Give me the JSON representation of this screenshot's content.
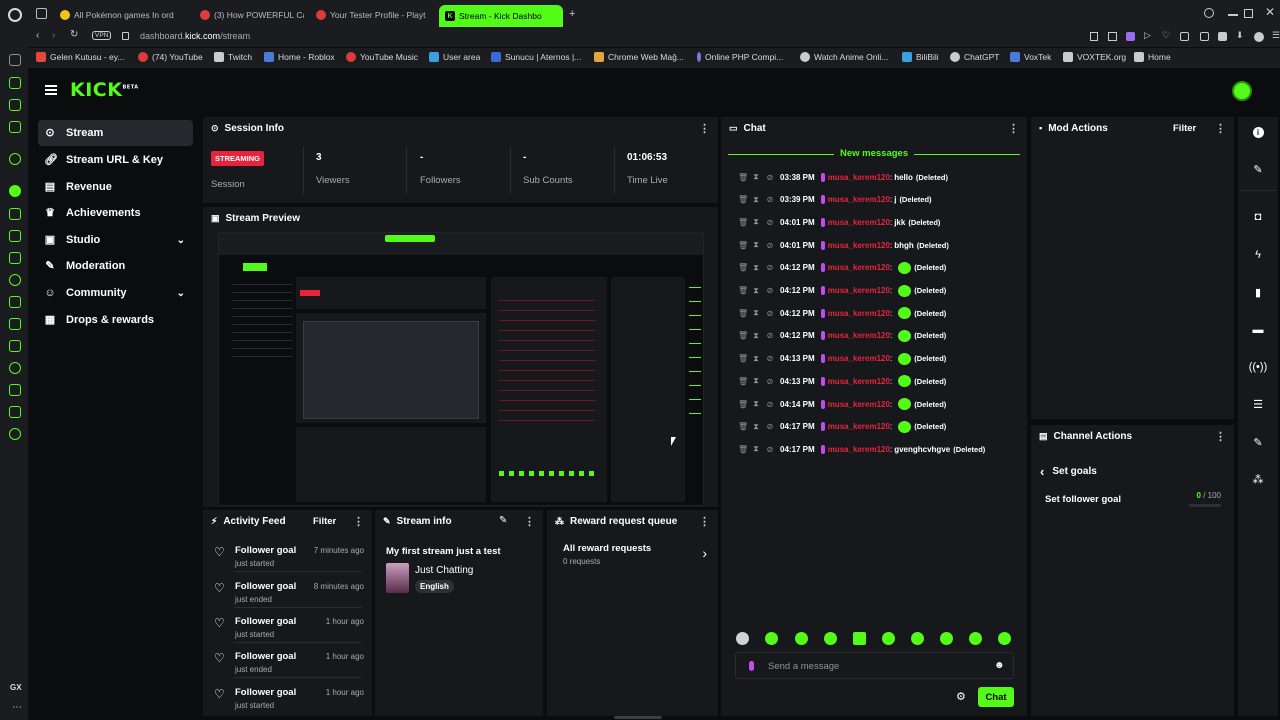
{
  "browser": {
    "tabs": [
      {
        "label": "All Pokémon games In ord",
        "favicon_color": "#f4c21c"
      },
      {
        "label": "(3) How POWERFUL Can",
        "favicon_color": "#e03b3b"
      },
      {
        "label": "Your Tester Profile - Playt",
        "favicon_color": "#e03b3b"
      },
      {
        "label": "Stream - Kick Dashbo",
        "favicon_color": "#000000"
      }
    ],
    "new_tab": "+",
    "vpn": "VPN",
    "url_prefix": "dashboard.",
    "url_host": "kick.com",
    "url_path": "/stream",
    "bookmarks": [
      "Gelen Kutusu - ey...",
      "(74) YouTube",
      "Twitch",
      "Home - Roblox",
      "YouTube Music",
      "User area",
      "Sunucu | Aternos |...",
      "Chrome Web Mağ...",
      "Online PHP Compi...",
      "Watch Anime Onli...",
      "BiliBili",
      "ChatGPT",
      "VoxTek",
      "VOXTEK.org",
      "Home"
    ]
  },
  "kick": {
    "logo": "KICK",
    "beta": "BETA",
    "accent": "#53fc18"
  },
  "nav": [
    {
      "label": "Stream",
      "icon": "broadcast-icon"
    },
    {
      "label": "Stream URL & Key",
      "icon": "link-icon"
    },
    {
      "label": "Revenue",
      "icon": "chart-icon"
    },
    {
      "label": "Achievements",
      "icon": "trophy-icon"
    },
    {
      "label": "Studio",
      "icon": "studio-icon"
    },
    {
      "label": "Moderation",
      "icon": "wrench-icon"
    },
    {
      "label": "Community",
      "icon": "users-icon"
    },
    {
      "label": "Drops & rewards",
      "icon": "gift-icon"
    }
  ],
  "session": {
    "title": "Session Info",
    "badge": "STREAMING",
    "badge_label": "Session",
    "viewers_value": "3",
    "viewers_label": "Viewers",
    "followers_value": "-",
    "followers_label": "Followers",
    "subs_value": "-",
    "subs_label": "Sub Counts",
    "time_value": "01:06:53",
    "time_label": "Time Live"
  },
  "preview": {
    "title": "Stream Preview"
  },
  "activity": {
    "title": "Activity Feed",
    "filter": "Filter",
    "items": [
      {
        "title": "Follower goal",
        "sub": "just started",
        "when": "7 minutes ago"
      },
      {
        "title": "Follower goal",
        "sub": "just ended",
        "when": "8 minutes ago"
      },
      {
        "title": "Follower goal",
        "sub": "just started",
        "when": "1 hour ago"
      },
      {
        "title": "Follower goal",
        "sub": "just ended",
        "when": "1 hour ago"
      },
      {
        "title": "Follower goal",
        "sub": "just started",
        "when": "1 hour ago"
      }
    ]
  },
  "stream_info": {
    "title": "Stream info",
    "stream_title": "My first stream just a test",
    "category": "Just Chatting",
    "language": "English"
  },
  "rewards": {
    "title": "Reward request queue",
    "all_label": "All reward requests",
    "count_label": "0 requests"
  },
  "chat": {
    "title": "Chat",
    "new_messages": "New messages",
    "user": "musa_kerem120",
    "messages": [
      {
        "time": "03:38 PM",
        "text": "hello",
        "deleted": "(Deleted)",
        "emote": false
      },
      {
        "time": "03:39 PM",
        "text": "j",
        "deleted": "(Deleted)",
        "emote": false
      },
      {
        "time": "04:01 PM",
        "text": "jkk",
        "deleted": "(Deleted)",
        "emote": false
      },
      {
        "time": "04:01 PM",
        "text": "bhgh",
        "deleted": "(Deleted)",
        "emote": false
      },
      {
        "time": "04:12 PM",
        "text": "",
        "deleted": "(Deleted)",
        "emote": true
      },
      {
        "time": "04:12 PM",
        "text": "",
        "deleted": "(Deleted)",
        "emote": true
      },
      {
        "time": "04:12 PM",
        "text": "",
        "deleted": "(Deleted)",
        "emote": true
      },
      {
        "time": "04:12 PM",
        "text": "",
        "deleted": "(Deleted)",
        "emote": true
      },
      {
        "time": "04:13 PM",
        "text": "",
        "deleted": "(Deleted)",
        "emote": true
      },
      {
        "time": "04:13 PM",
        "text": "",
        "deleted": "(Deleted)",
        "emote": true
      },
      {
        "time": "04:14 PM",
        "text": "",
        "deleted": "(Deleted)",
        "emote": true
      },
      {
        "time": "04:17 PM",
        "text": "",
        "deleted": "(Deleted)",
        "emote": true
      },
      {
        "time": "04:17 PM",
        "text": "gvenghcvhgve",
        "deleted": "(Deleted)",
        "emote": false
      }
    ],
    "input_placeholder": "Send a message",
    "send_label": "Chat"
  },
  "mod_actions": {
    "title": "Mod Actions",
    "filter": "Filter"
  },
  "channel_actions": {
    "title": "Channel Actions",
    "back_label": "Set goals",
    "goal_label": "Set follower goal",
    "goal_current": "0",
    "goal_total": "/ 100"
  }
}
